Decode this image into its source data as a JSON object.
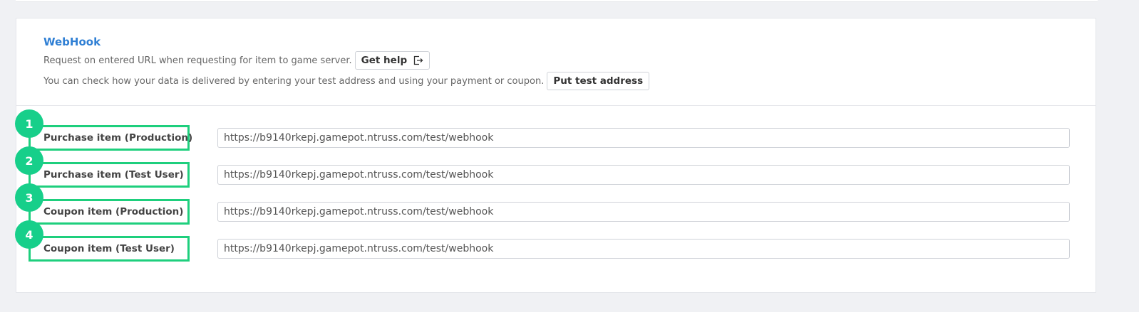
{
  "webhook": {
    "title": "WebHook",
    "description_1": "Request on entered URL when requesting for item to game server.",
    "help_button": "Get help",
    "description_2": "You can check how your data is delivered by entering your test address and using your payment or coupon.",
    "test_address_button": "Put test address"
  },
  "rows": [
    {
      "badge": "1",
      "label": "Purchase item (Production)",
      "url": "https://b9140rkepj.gamepot.ntruss.com/test/webhook"
    },
    {
      "badge": "2",
      "label": "Purchase item (Test User)",
      "url": "https://b9140rkepj.gamepot.ntruss.com/test/webhook"
    },
    {
      "badge": "3",
      "label": "Coupon item (Production)",
      "url": "https://b9140rkepj.gamepot.ntruss.com/test/webhook"
    },
    {
      "badge": "4",
      "label": "Coupon item (Test User)",
      "url": "https://b9140rkepj.gamepot.ntruss.com/test/webhook"
    }
  ],
  "colors": {
    "accent": "#2f7fd4",
    "highlight": "#1ecf7d",
    "badge": "#17cf8a"
  },
  "icons": {
    "help": "external-link-icon"
  }
}
